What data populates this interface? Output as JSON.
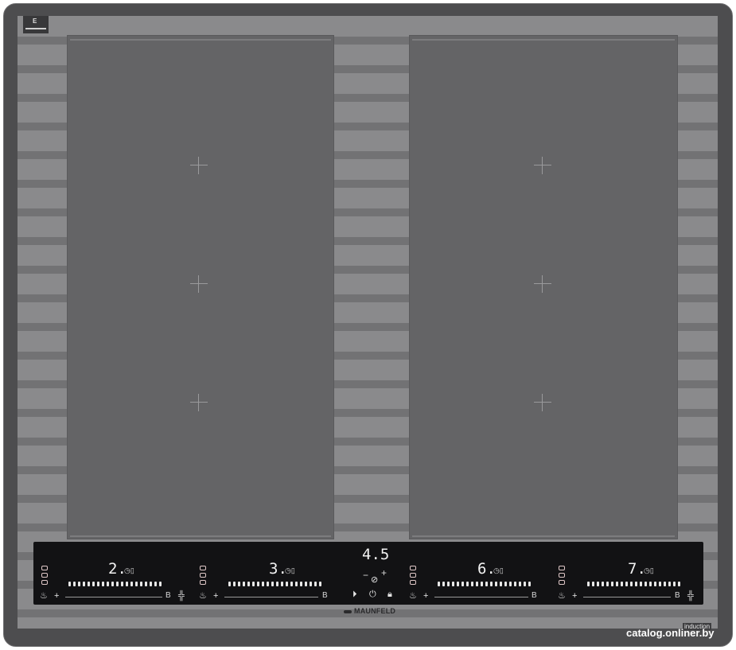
{
  "hob": {
    "badge_label": "E",
    "brand": "MAUNFELD",
    "induction_label": "induction"
  },
  "control_panel": {
    "timer_display": "4.5",
    "zones": [
      {
        "level": "2.",
        "boost": "B"
      },
      {
        "level": "3.",
        "boost": "B"
      },
      {
        "level": "6.",
        "boost": "B"
      },
      {
        "level": "7.",
        "boost": "B"
      }
    ],
    "timer_minus": "−",
    "timer_plus": "+",
    "pause_icon": "play-pause-icon",
    "power_icon": "power-icon",
    "lock_icon": "lock-icon"
  },
  "watermark": "catalog.onliner.by"
}
